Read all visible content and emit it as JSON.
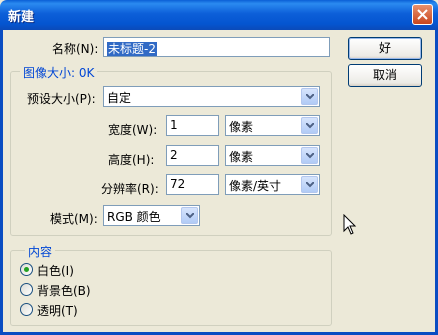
{
  "window": {
    "title": "新建"
  },
  "buttons": {
    "ok_label": "好",
    "cancel_label": "取消"
  },
  "name": {
    "label": "名称(N):",
    "value": "未标题-2"
  },
  "image_size": {
    "group_title": "图像大小: 0K",
    "preset": {
      "label": "预设大小(P):",
      "value": "自定"
    },
    "width": {
      "label": "宽度(W):",
      "value": "1",
      "unit": "像素"
    },
    "height": {
      "label": "高度(H):",
      "value": "2",
      "unit": "像素"
    },
    "resolution": {
      "label": "分辨率(R):",
      "value": "72",
      "unit": "像素/英寸"
    },
    "mode": {
      "label": "模式(M):",
      "value": "RGB 颜色"
    }
  },
  "contents": {
    "group_title": "内容",
    "options": [
      {
        "label": "白色(I)",
        "checked": true
      },
      {
        "label": "背景色(B)",
        "checked": false
      },
      {
        "label": "透明(T)",
        "checked": false
      }
    ]
  },
  "icons": {
    "close": "close-icon",
    "dropdown": "chevron-down-icon",
    "cursor": "mouse-pointer-icon"
  }
}
